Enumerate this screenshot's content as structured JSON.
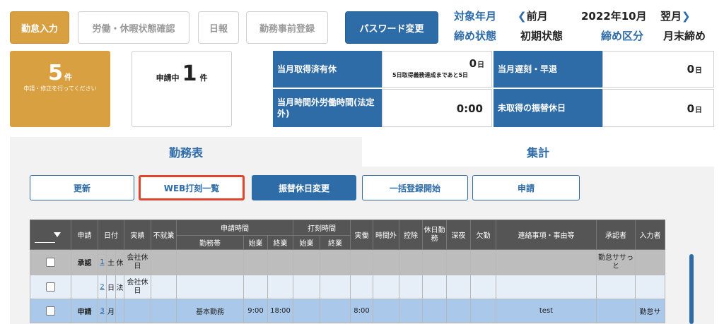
{
  "nav": {
    "attendance_input": "勤怠入力",
    "work_leave_status": "労働・休暇状態確認",
    "daily_report": "日報",
    "pre_registration": "勤務事前登録",
    "password_change": "パスワード変更"
  },
  "period": {
    "target_label": "対象年月",
    "prev_label": "前月",
    "current": "2022年10月",
    "next_label": "翌月",
    "close_state_label": "締め状態",
    "close_state_value": "初期状態",
    "close_type_label": "締め区分",
    "close_type_value": "月末締め"
  },
  "summary": {
    "pending_count": "5",
    "pending_unit": "件",
    "pending_sub": "申請・修正を行ってください",
    "requesting_label": "申請中",
    "requesting_count": "1",
    "requesting_unit": "件"
  },
  "stats": {
    "paid_leave_label": "当月取得済有休",
    "paid_leave_value": "0",
    "paid_leave_unit": "日",
    "paid_leave_note": "5日取得義務達成まであと5日",
    "late_label": "当月遅刻・早退",
    "late_value": "0",
    "late_unit": "日",
    "overtime_label": "当月時間外労働時間(法定外)",
    "overtime_value": "0:00",
    "substitute_label": "未取得の振替休日",
    "substitute_value": "0",
    "substitute_unit": "日"
  },
  "tabs": {
    "schedule": "勤務表",
    "summary": "集計"
  },
  "actions": {
    "refresh": "更新",
    "web_stamp_list": "WEB打刻一覧",
    "substitute_change": "振替休日変更",
    "bulk_register": "一括登録開始",
    "apply": "申請"
  },
  "table": {
    "headers": {
      "request": "申請",
      "date": "日付",
      "result": "実績",
      "non_working": "不就業",
      "request_time": "申請時間",
      "work_band": "勤務帯",
      "start": "始業",
      "end": "終業",
      "stamp_time": "打刻時間",
      "stamp_start": "始業",
      "stamp_end": "終業",
      "actual": "実働",
      "overtime": "時間外",
      "deduction": "控除",
      "holiday_work": "休日勤務",
      "late_night": "深夜",
      "absence": "欠勤",
      "notes": "連絡事項・事由等",
      "approver": "承認者",
      "inputter": "入力者"
    },
    "rows": [
      {
        "request": "承認",
        "day": "1",
        "weekday": "土",
        "type": "休",
        "result": "会社休日",
        "work_band": "",
        "start": "",
        "end": "",
        "actual": "",
        "notes": "",
        "approver": "勤怠ササっと",
        "inputter": ""
      },
      {
        "request": "",
        "day": "2",
        "weekday": "日",
        "type": "法",
        "result": "会社休日",
        "work_band": "",
        "start": "",
        "end": "",
        "actual": "",
        "notes": "",
        "approver": "",
        "inputter": ""
      },
      {
        "request": "申請",
        "day": "3",
        "weekday": "月",
        "type": "",
        "result": "",
        "work_band": "基本勤務",
        "start": "9:00",
        "end": "18:00",
        "actual": "8:00",
        "notes": "test",
        "approver": "",
        "inputter": "勤怠サ"
      }
    ]
  },
  "colors": {
    "accent": "#2e6ca8",
    "orange": "#d8a040",
    "highlight": "#e0442b"
  }
}
